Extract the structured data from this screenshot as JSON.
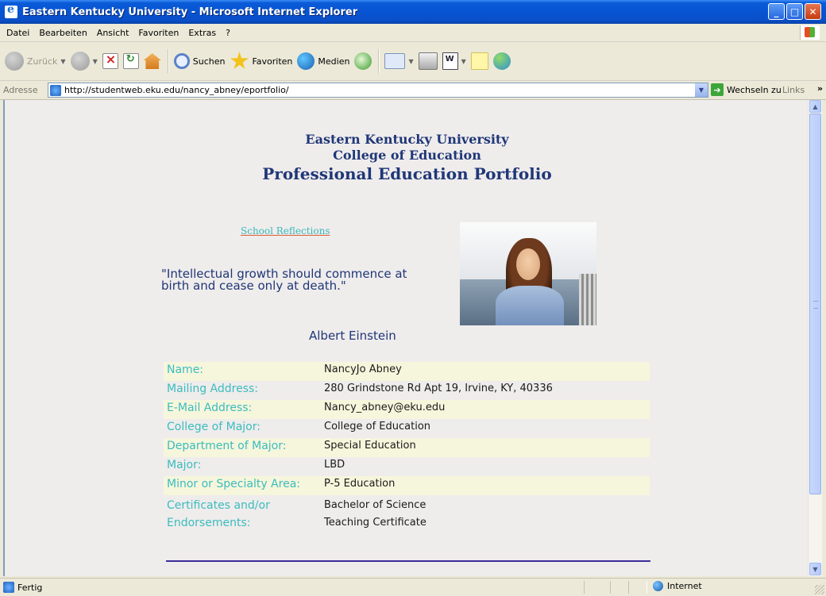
{
  "window": {
    "title": "Eastern Kentucky University - Microsoft Internet Explorer",
    "controls": [
      "minimize",
      "maximize",
      "close"
    ]
  },
  "menubar": {
    "items": [
      "Datei",
      "Bearbeiten",
      "Ansicht",
      "Favoriten",
      "Extras",
      "?"
    ]
  },
  "toolbar": {
    "back_label": "Zurück",
    "search_label": "Suchen",
    "favorites_label": "Favoriten",
    "media_label": "Medien"
  },
  "address": {
    "label": "Adresse",
    "url": "http://studentweb.eku.edu/nancy_abney/eportfolio/",
    "go_label": "Wechseln zu",
    "links_label": "Links"
  },
  "page": {
    "header": {
      "line1": "Eastern Kentucky University",
      "line2": "College of Education",
      "line3": "Professional Education Portfolio"
    },
    "reflections_link": "School Reflections",
    "quote": "\"Intellectual growth should commence at birth and cease only at death.\"",
    "author": "Albert Einstein",
    "info": [
      {
        "label": "Name:",
        "value": "NancyJo Abney"
      },
      {
        "label": "Mailing Address:",
        "value": "280 Grindstone Rd Apt 19, Irvine, KY, 40336"
      },
      {
        "label": "E-Mail Address:",
        "value": "Nancy_abney@eku.edu"
      },
      {
        "label": "College of Major:",
        "value": "College of Education"
      },
      {
        "label": "Department of Major:",
        "value": "Special Education"
      },
      {
        "label": "Major:",
        "value": "LBD"
      },
      {
        "label": "Minor or Specialty Area:",
        "value": "P-5 Education"
      },
      {
        "label": "Certificates and/or Endorsements:",
        "value": "Bachelor of Science",
        "value2": "Teaching Certificate"
      }
    ]
  },
  "statusbar": {
    "status": "Fertig",
    "zone": "Internet"
  },
  "colors": {
    "header_text": "#1f3777",
    "label_teal": "#3bbcbd",
    "row_highlight": "#f6f6dc",
    "divider": "#3c2e9a"
  }
}
